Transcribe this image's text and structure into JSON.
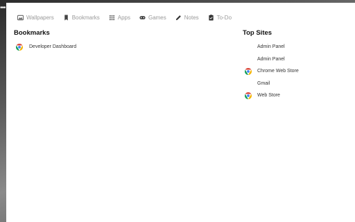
{
  "nav": {
    "items": [
      {
        "label": "Wallpapers",
        "icon": "wallpaper-icon"
      },
      {
        "label": "Bookmarks",
        "icon": "bookmark-icon"
      },
      {
        "label": "Apps",
        "icon": "apps-grid-icon"
      },
      {
        "label": "Games",
        "icon": "gamepad-icon"
      },
      {
        "label": "Notes",
        "icon": "pencil-icon"
      },
      {
        "label": "To-Do",
        "icon": "checklist-icon"
      }
    ]
  },
  "bookmarks": {
    "title": "Bookmarks",
    "items": [
      {
        "label": "Developer Dashboard",
        "icon": "chrome-icon"
      }
    ]
  },
  "top_sites": {
    "title": "Top Sites",
    "items": [
      {
        "label": "Admin Panel",
        "icon": ""
      },
      {
        "label": "Admin Panel",
        "icon": ""
      },
      {
        "label": "Chrome Web Store",
        "icon": "chrome-icon"
      },
      {
        "label": "Gmail",
        "icon": ""
      },
      {
        "label": "Web Store",
        "icon": "chrome-icon"
      }
    ]
  },
  "colors": {
    "nav_text": "#9a9a9a",
    "chrome_red": "#db4437",
    "chrome_yellow": "#f4b400",
    "chrome_green": "#0f9d58",
    "chrome_blue": "#4285f4"
  }
}
